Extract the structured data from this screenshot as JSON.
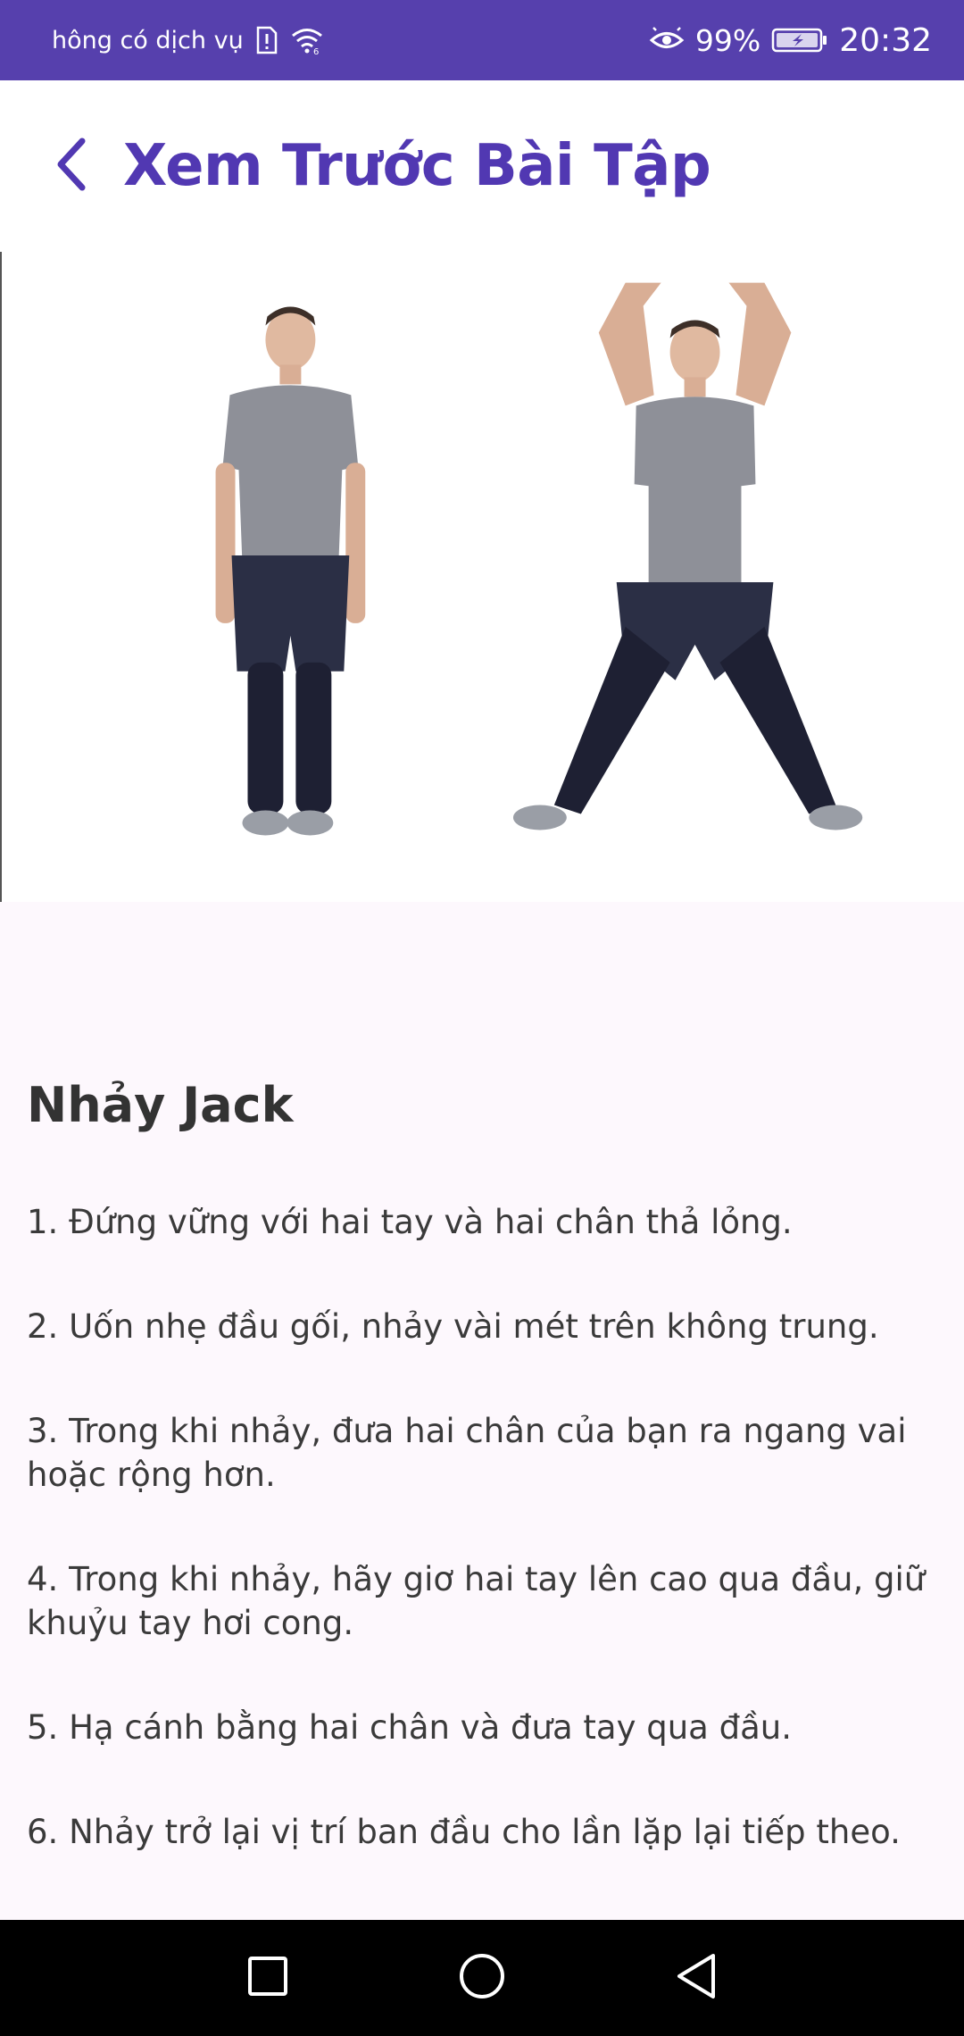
{
  "status_bar": {
    "carrier": "hông có dịch vụ",
    "battery_percent": "99%",
    "time": "20:32",
    "icons": [
      "sim-alert-icon",
      "wifi-icon",
      "eye-comfort-icon",
      "battery-icon"
    ]
  },
  "app_bar": {
    "back_icon": "chevron-left-icon",
    "title": "Xem Trước Bài Tập"
  },
  "exercise": {
    "name": "Nhảy Jack",
    "steps": [
      "1. Đứng vững với hai tay và hai chân thả lỏng.",
      "2. Uốn nhẹ đầu gối, nhảy vài mét trên không trung.",
      "3. Trong khi nhảy, đưa hai chân của bạn ra ngang vai hoặc rộng hơn.",
      "4. Trong khi nhảy, hãy giơ hai tay lên cao qua đầu, giữ khuỷu tay hơi cong.",
      "5. Hạ cánh bằng hai chân và đưa tay qua đầu.",
      "6. Nhảy trở lại vị trí ban đầu cho lần lặp lại tiếp theo."
    ]
  },
  "colors": {
    "accent": "#5640ad",
    "title": "#5138b2",
    "background": "#fdf8fd",
    "text": "#3a3a3a"
  },
  "nav_bar": {
    "icons": [
      "recents-square-icon",
      "home-circle-icon",
      "back-triangle-icon"
    ]
  }
}
